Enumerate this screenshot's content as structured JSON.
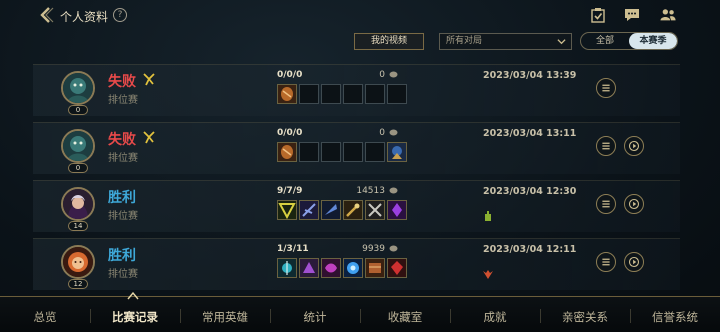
{
  "header": {
    "title": "个人资料",
    "help_symbol": "?"
  },
  "filters": {
    "my_videos_label": "我的视频",
    "match_type_value": "所有对局",
    "season_options": [
      "全部",
      "本赛季"
    ],
    "season_selected": "本赛季"
  },
  "matches": [
    {
      "result": "失败",
      "outcome": "lose",
      "mode": "排位赛",
      "level": "0",
      "kda": "0/0/0",
      "gold": "0",
      "date": "2023/03/04 13:39",
      "items_filled": 1,
      "has_replay": false,
      "has_badge": false
    },
    {
      "result": "失败",
      "outcome": "lose",
      "mode": "排位赛",
      "level": "0",
      "kda": "0/0/0",
      "gold": "0",
      "date": "2023/03/04 13:11",
      "items_filled": 2,
      "has_replay": true,
      "has_badge": false
    },
    {
      "result": "胜利",
      "outcome": "win",
      "mode": "排位赛",
      "level": "14",
      "kda": "9/7/9",
      "gold": "14513",
      "date": "2023/03/04 12:30",
      "items_filled": 6,
      "has_replay": true,
      "has_badge": true
    },
    {
      "result": "胜利",
      "outcome": "win",
      "mode": "排位赛",
      "level": "12",
      "kda": "1/3/11",
      "gold": "9939",
      "date": "2023/03/04 12:11",
      "items_filled": 6,
      "has_replay": true,
      "has_badge": true
    }
  ],
  "nav": {
    "tabs": [
      "总览",
      "比赛记录",
      "常用英雄",
      "统计",
      "收藏室",
      "成就",
      "亲密关系",
      "信誉系统"
    ],
    "active": "比赛记录"
  },
  "colors": {
    "lose": "#e84a4a",
    "win": "#3ea8d8",
    "gold_accent": "#cdbe91"
  }
}
